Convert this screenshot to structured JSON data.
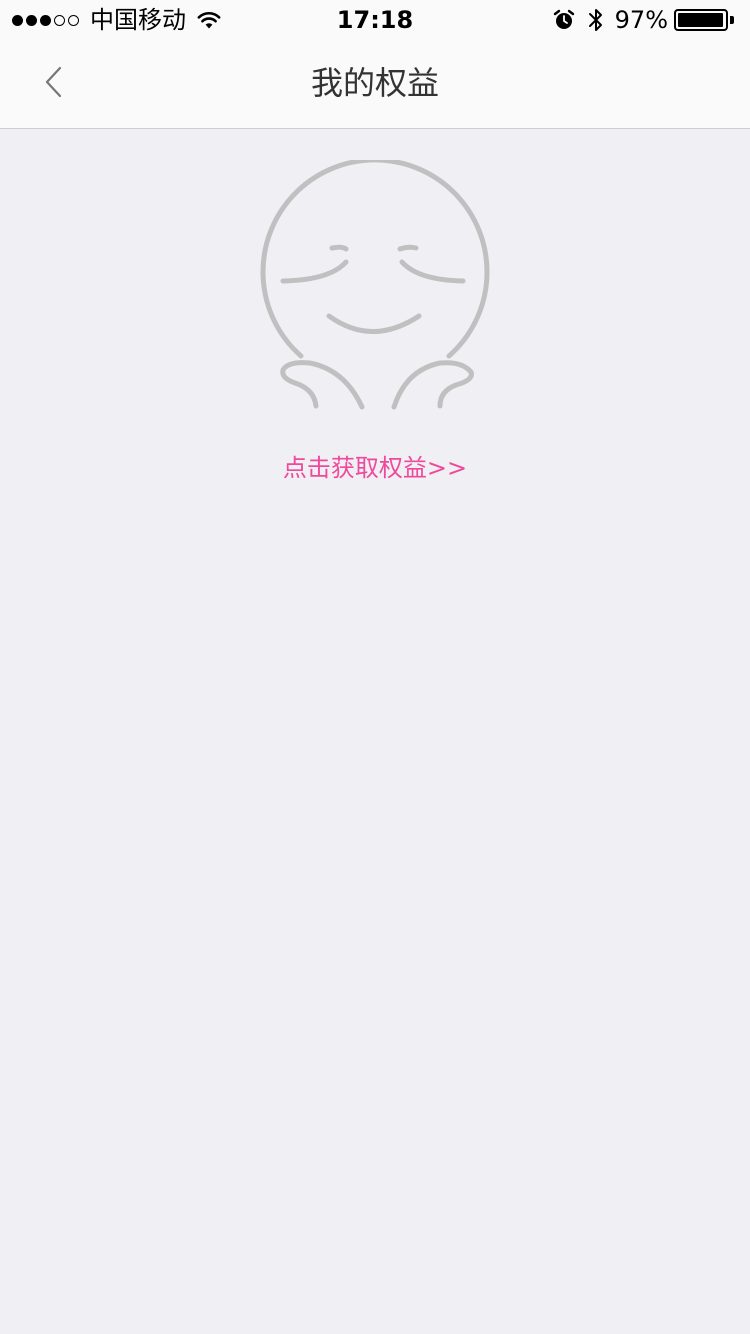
{
  "status_bar": {
    "carrier": "中国移动",
    "time": "17:18",
    "battery_percent": "97%",
    "battery_level": 0.97,
    "signal_bars_filled": 3,
    "signal_bars_total": 5,
    "icons": [
      "wifi-icon",
      "alarm-icon",
      "bluetooth-icon",
      "battery-icon"
    ]
  },
  "nav": {
    "title": "我的权益",
    "back_icon": "chevron-left-icon"
  },
  "empty_state": {
    "illustration": "smiling-face-icon",
    "link_text": "点击获取权益>>"
  },
  "colors": {
    "background": "#efeff4",
    "bar_background": "#fafafa",
    "accent_pink": "#f0489b",
    "illustration_gray": "#c0c0c0",
    "title_text": "#333333"
  }
}
